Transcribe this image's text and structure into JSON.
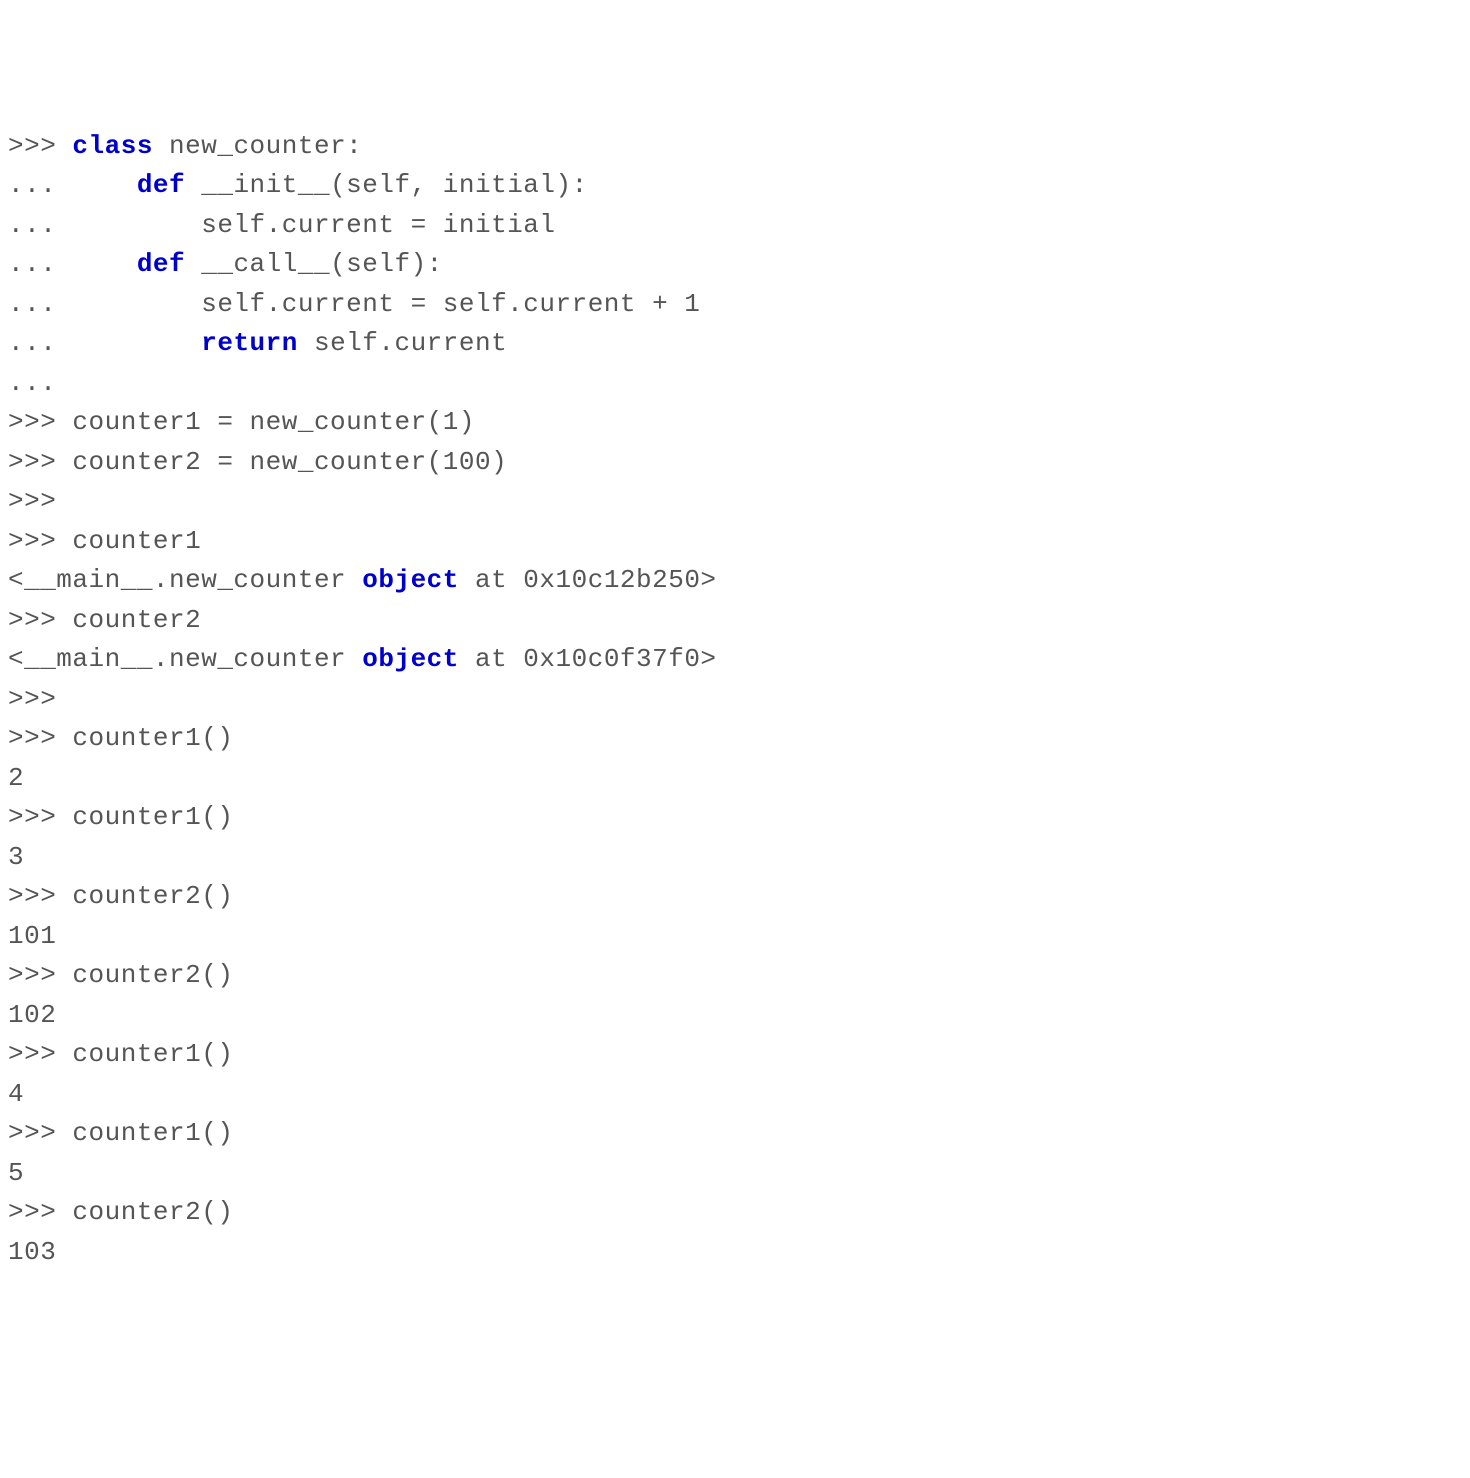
{
  "lines": [
    {
      "segments": [
        {
          "t": ">>> ",
          "c": "prompt"
        },
        {
          "t": "class",
          "c": "keyword"
        },
        {
          "t": " new_counter:",
          "c": "text"
        }
      ]
    },
    {
      "segments": [
        {
          "t": "...     ",
          "c": "prompt"
        },
        {
          "t": "def",
          "c": "keyword"
        },
        {
          "t": " __init__(self, initial):",
          "c": "text"
        }
      ]
    },
    {
      "segments": [
        {
          "t": "...         self.current = initial",
          "c": "text"
        }
      ]
    },
    {
      "segments": [
        {
          "t": "...     ",
          "c": "prompt"
        },
        {
          "t": "def",
          "c": "keyword"
        },
        {
          "t": " __call__(self):",
          "c": "text"
        }
      ]
    },
    {
      "segments": [
        {
          "t": "...         self.current = self.current + 1",
          "c": "text"
        }
      ]
    },
    {
      "segments": [
        {
          "t": "...         ",
          "c": "prompt"
        },
        {
          "t": "return",
          "c": "keyword"
        },
        {
          "t": " self.current",
          "c": "text"
        }
      ]
    },
    {
      "segments": [
        {
          "t": "...",
          "c": "prompt"
        }
      ]
    },
    {
      "segments": [
        {
          "t": ">>> counter1 = new_counter(1)",
          "c": "text"
        }
      ]
    },
    {
      "segments": [
        {
          "t": ">>> counter2 = new_counter(100)",
          "c": "text"
        }
      ]
    },
    {
      "segments": [
        {
          "t": ">>>",
          "c": "prompt"
        }
      ]
    },
    {
      "segments": [
        {
          "t": ">>> counter1",
          "c": "text"
        }
      ]
    },
    {
      "segments": [
        {
          "t": "<__main__.new_counter ",
          "c": "text"
        },
        {
          "t": "object",
          "c": "keyword"
        },
        {
          "t": " at 0x10c12b250>",
          "c": "text"
        }
      ]
    },
    {
      "segments": [
        {
          "t": ">>> counter2",
          "c": "text"
        }
      ]
    },
    {
      "segments": [
        {
          "t": "<__main__.new_counter ",
          "c": "text"
        },
        {
          "t": "object",
          "c": "keyword"
        },
        {
          "t": " at 0x10c0f37f0>",
          "c": "text"
        }
      ]
    },
    {
      "segments": [
        {
          "t": ">>>",
          "c": "prompt"
        }
      ]
    },
    {
      "segments": [
        {
          "t": ">>> counter1()",
          "c": "text"
        }
      ]
    },
    {
      "segments": [
        {
          "t": "2",
          "c": "text"
        }
      ]
    },
    {
      "segments": [
        {
          "t": ">>> counter1()",
          "c": "text"
        }
      ]
    },
    {
      "segments": [
        {
          "t": "3",
          "c": "text"
        }
      ]
    },
    {
      "segments": [
        {
          "t": ">>> counter2()",
          "c": "text"
        }
      ]
    },
    {
      "segments": [
        {
          "t": "101",
          "c": "text"
        }
      ]
    },
    {
      "segments": [
        {
          "t": ">>> counter2()",
          "c": "text"
        }
      ]
    },
    {
      "segments": [
        {
          "t": "102",
          "c": "text"
        }
      ]
    },
    {
      "segments": [
        {
          "t": ">>> counter1()",
          "c": "text"
        }
      ]
    },
    {
      "segments": [
        {
          "t": "4",
          "c": "text"
        }
      ]
    },
    {
      "segments": [
        {
          "t": ">>> counter1()",
          "c": "text"
        }
      ]
    },
    {
      "segments": [
        {
          "t": "5",
          "c": "text"
        }
      ]
    },
    {
      "segments": [
        {
          "t": ">>> counter2()",
          "c": "text"
        }
      ]
    },
    {
      "segments": [
        {
          "t": "103",
          "c": "text"
        }
      ]
    }
  ]
}
